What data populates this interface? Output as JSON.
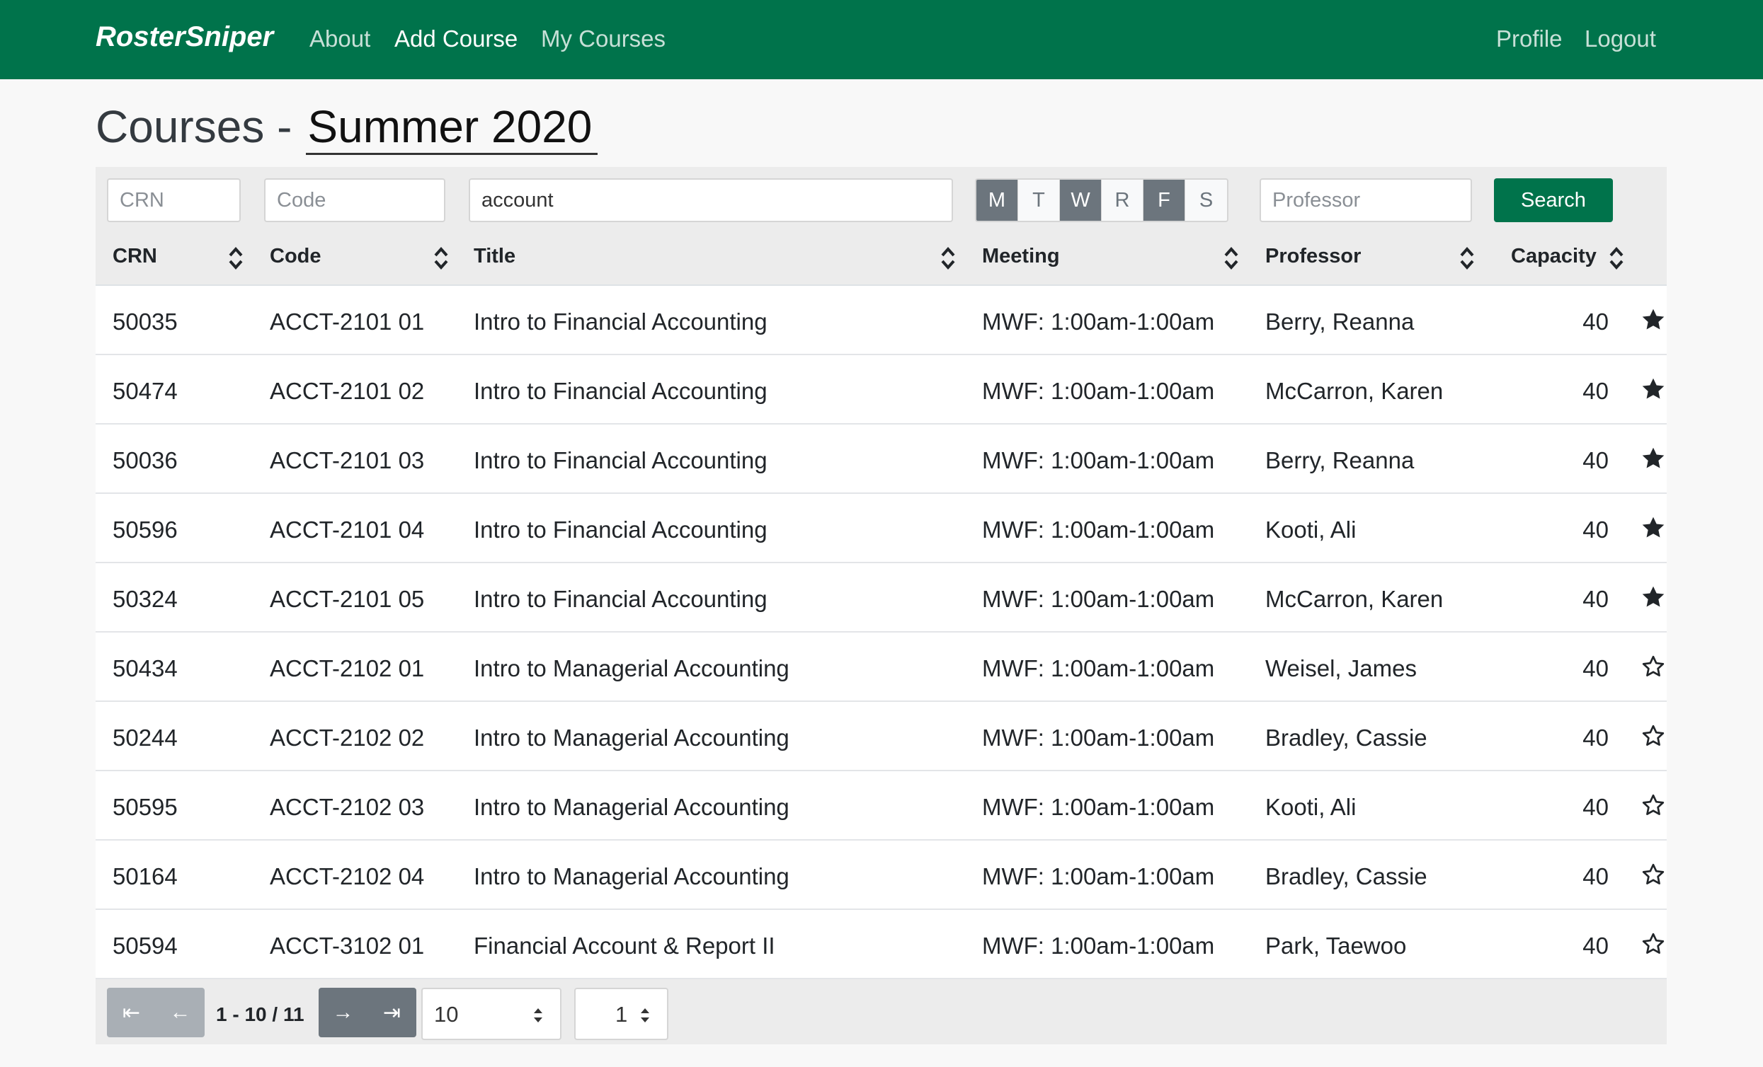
{
  "navbar": {
    "brand": "RosterSniper",
    "links": [
      {
        "label": "About",
        "active": false
      },
      {
        "label": "Add Course",
        "active": true
      },
      {
        "label": "My Courses",
        "active": false
      }
    ],
    "right_links": [
      {
        "label": "Profile"
      },
      {
        "label": "Logout"
      }
    ],
    "bg_color": "#00734b"
  },
  "page": {
    "title_prefix": "Courses -",
    "term": "Summer 2020"
  },
  "filters": {
    "crn_placeholder": "CRN",
    "code_placeholder": "Code",
    "title_value": "account",
    "days": [
      {
        "label": "M",
        "selected": true
      },
      {
        "label": "T",
        "selected": false
      },
      {
        "label": "W",
        "selected": true
      },
      {
        "label": "R",
        "selected": false
      },
      {
        "label": "F",
        "selected": true
      },
      {
        "label": "S",
        "selected": false
      }
    ],
    "professor_placeholder": "Professor",
    "search_label": "Search"
  },
  "table": {
    "columns": [
      "CRN",
      "Code",
      "Title",
      "Meeting",
      "Professor",
      "Capacity"
    ],
    "rows": [
      {
        "crn": "50035",
        "code": "ACCT-2101 01",
        "title": "Intro to Financial Accounting",
        "meeting": "MWF: 1:00am-1:00am",
        "professor": "Berry, Reanna",
        "capacity": "40",
        "starred": true
      },
      {
        "crn": "50474",
        "code": "ACCT-2101 02",
        "title": "Intro to Financial Accounting",
        "meeting": "MWF: 1:00am-1:00am",
        "professor": "McCarron, Karen",
        "capacity": "40",
        "starred": true
      },
      {
        "crn": "50036",
        "code": "ACCT-2101 03",
        "title": "Intro to Financial Accounting",
        "meeting": "MWF: 1:00am-1:00am",
        "professor": "Berry, Reanna",
        "capacity": "40",
        "starred": true
      },
      {
        "crn": "50596",
        "code": "ACCT-2101 04",
        "title": "Intro to Financial Accounting",
        "meeting": "MWF: 1:00am-1:00am",
        "professor": "Kooti, Ali",
        "capacity": "40",
        "starred": true
      },
      {
        "crn": "50324",
        "code": "ACCT-2101 05",
        "title": "Intro to Financial Accounting",
        "meeting": "MWF: 1:00am-1:00am",
        "professor": "McCarron, Karen",
        "capacity": "40",
        "starred": true
      },
      {
        "crn": "50434",
        "code": "ACCT-2102 01",
        "title": "Intro to Managerial Accounting",
        "meeting": "MWF: 1:00am-1:00am",
        "professor": "Weisel, James",
        "capacity": "40",
        "starred": false
      },
      {
        "crn": "50244",
        "code": "ACCT-2102 02",
        "title": "Intro to Managerial Accounting",
        "meeting": "MWF: 1:00am-1:00am",
        "professor": "Bradley, Cassie",
        "capacity": "40",
        "starred": false
      },
      {
        "crn": "50595",
        "code": "ACCT-2102 03",
        "title": "Intro to Managerial Accounting",
        "meeting": "MWF: 1:00am-1:00am",
        "professor": "Kooti, Ali",
        "capacity": "40",
        "starred": false
      },
      {
        "crn": "50164",
        "code": "ACCT-2102 04",
        "title": "Intro to Managerial Accounting",
        "meeting": "MWF: 1:00am-1:00am",
        "professor": "Bradley, Cassie",
        "capacity": "40",
        "starred": false
      },
      {
        "crn": "50594",
        "code": "ACCT-3102 01",
        "title": "Financial Account & Report II",
        "meeting": "MWF: 1:00am-1:00am",
        "professor": "Park, Taewoo",
        "capacity": "40",
        "starred": false
      }
    ]
  },
  "pagination": {
    "first_icon": "⇤",
    "prev_icon": "←",
    "range_label": "1 - 10 / 11",
    "next_icon": "→",
    "last_icon": "⇥",
    "page_size": "10",
    "page_number": "1"
  }
}
